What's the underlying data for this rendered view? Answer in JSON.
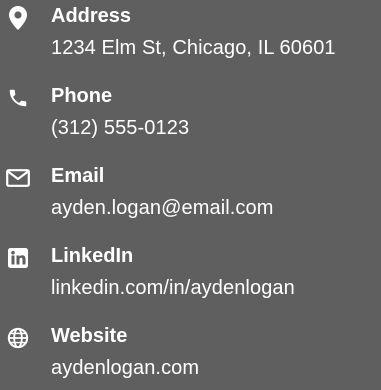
{
  "contact": {
    "items": [
      {
        "icon": "map-pin-icon",
        "label": "Address",
        "value": "1234 Elm St, Chicago, IL 60601"
      },
      {
        "icon": "phone-icon",
        "label": "Phone",
        "value": "(312) 555-0123"
      },
      {
        "icon": "envelope-icon",
        "label": "Email",
        "value": "ayden.logan@email.com"
      },
      {
        "icon": "linkedin-icon",
        "label": "LinkedIn",
        "value": "linkedin.com/in/aydenlogan"
      },
      {
        "icon": "globe-icon",
        "label": "Website",
        "value": "aydenlogan.com"
      }
    ]
  },
  "colors": {
    "background": "#5f5f5f",
    "text": "#ffffff"
  }
}
